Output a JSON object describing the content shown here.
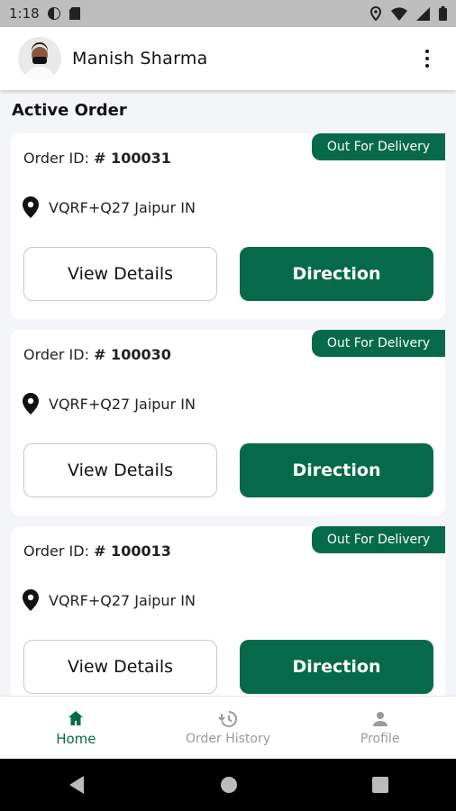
{
  "status_bar": {
    "time": "1:18"
  },
  "header": {
    "user_name": "Manish Sharma"
  },
  "section": {
    "title": "Active Order"
  },
  "orders": [
    {
      "id_label": "Order ID:",
      "id_value": "# 100031",
      "status": "Out For Delivery",
      "location": "VQRF+Q27 Jaipur IN",
      "details_label": "View Details",
      "direction_label": "Direction"
    },
    {
      "id_label": "Order ID:",
      "id_value": "# 100030",
      "status": "Out For Delivery",
      "location": "VQRF+Q27 Jaipur IN",
      "details_label": "View Details",
      "direction_label": "Direction"
    },
    {
      "id_label": "Order ID:",
      "id_value": "# 100013",
      "status": "Out For Delivery",
      "location": "VQRF+Q27 Jaipur IN",
      "details_label": "View Details",
      "direction_label": "Direction"
    }
  ],
  "bottom_nav": {
    "items": [
      {
        "label": "Home",
        "icon": "home-icon",
        "active": true
      },
      {
        "label": "Order History",
        "icon": "history-icon",
        "active": false
      },
      {
        "label": "Profile",
        "icon": "person-icon",
        "active": false
      }
    ]
  },
  "colors": {
    "accent": "#066a4a",
    "inactive": "#9a9a9a"
  }
}
